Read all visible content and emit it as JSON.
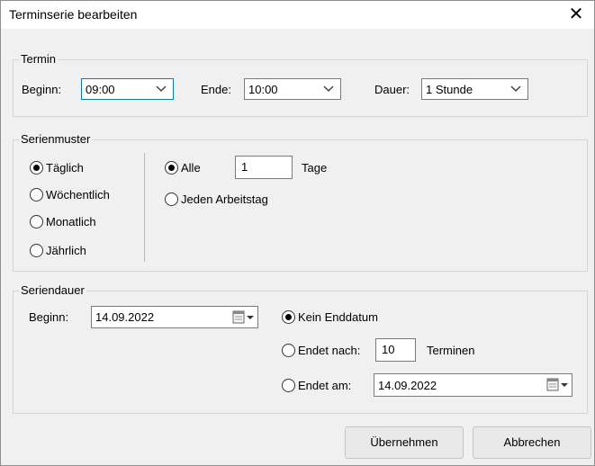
{
  "window": {
    "title": "Terminserie bearbeiten",
    "close_glyph": "✕"
  },
  "termin": {
    "legend": "Termin",
    "beginn_label": "Beginn:",
    "beginn_value": "09:00",
    "ende_label": "Ende:",
    "ende_value": "10:00",
    "dauer_label": "Dauer:",
    "dauer_value": "1 Stunde"
  },
  "serienmuster": {
    "legend": "Serienmuster",
    "options": [
      {
        "label": "Täglich",
        "checked": true
      },
      {
        "label": "Wöchentlich",
        "checked": false
      },
      {
        "label": "Monatlich",
        "checked": false
      },
      {
        "label": "Jährlich",
        "checked": false
      }
    ],
    "alle_label": "Alle",
    "alle_checked": true,
    "interval_value": "1",
    "tage_label": "Tage",
    "arbeitstag_label": "Jeden Arbeitstag",
    "arbeitstag_checked": false
  },
  "seriendauer": {
    "legend": "Seriendauer",
    "beginn_label": "Beginn:",
    "beginn_date": "14.09.2022",
    "kein_enddatum_label": "Kein Enddatum",
    "kein_enddatum_checked": true,
    "endet_nach_label": "Endet nach:",
    "endet_nach_value": "10",
    "terminen_label": "Terminen",
    "endet_am_label": "Endet am:",
    "endet_am_date": "14.09.2022"
  },
  "buttons": {
    "apply": "Übernehmen",
    "cancel": "Abbrechen"
  },
  "colors": {
    "focus_border": "#0078d7",
    "dialog_bg": "#f0f0f0"
  },
  "icons": [
    "close-icon",
    "chevron-down-icon",
    "calendar-icon"
  ]
}
